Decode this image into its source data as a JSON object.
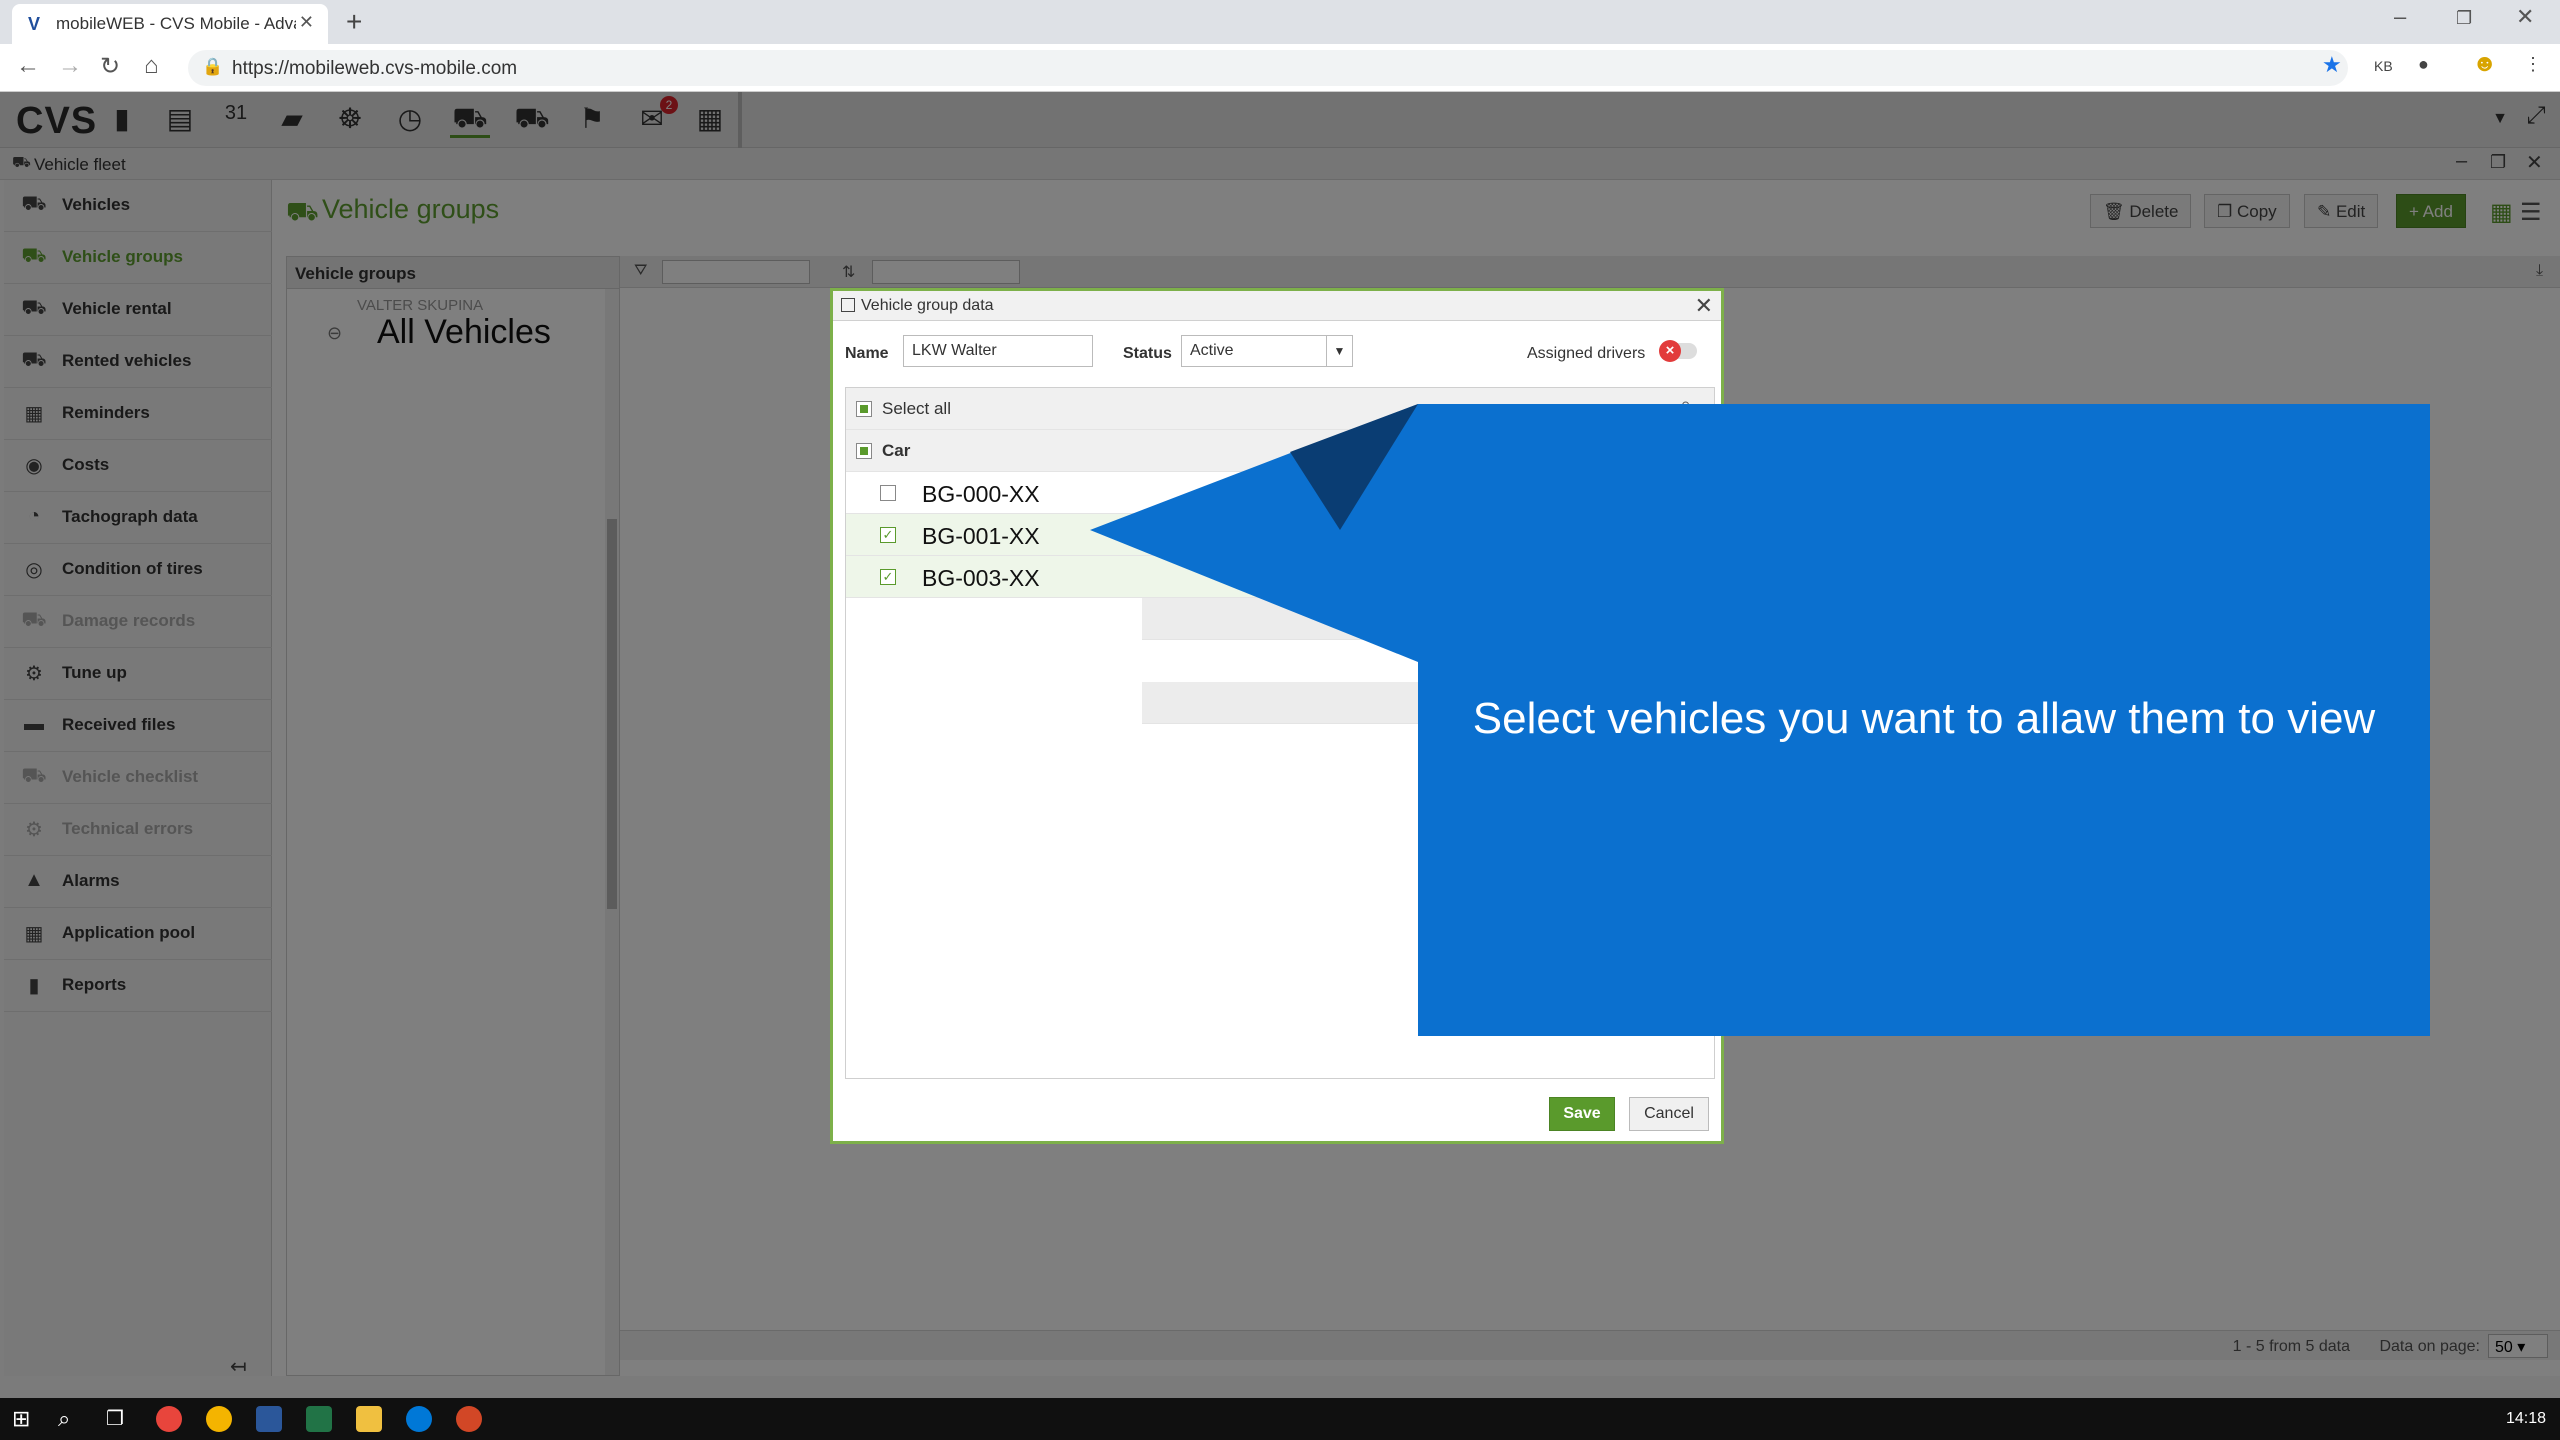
{
  "browser": {
    "tab_title": "mobileWEB - CVS Mobile - Adva",
    "favicon": "V",
    "url": "https://mobileweb.cvs-mobile.com"
  },
  "app": {
    "logo": "CVS",
    "message_badge": "2",
    "window_title": "Vehicle fleet",
    "page_title": "Vehicle groups",
    "toolbar_buttons": {
      "delete": "Delete",
      "copy": "Copy",
      "edit": "Edit",
      "add": "+ Add"
    }
  },
  "sidebar": {
    "items": [
      {
        "label": "Vehicles",
        "icon": "⛟",
        "state": "normal"
      },
      {
        "label": "Vehicle groups",
        "icon": "⛟",
        "state": "active"
      },
      {
        "label": "Vehicle rental",
        "icon": "⛟",
        "state": "normal"
      },
      {
        "label": "Rented vehicles",
        "icon": "⛟",
        "state": "normal"
      },
      {
        "label": "Reminders",
        "icon": "▦",
        "state": "normal"
      },
      {
        "label": "Costs",
        "icon": "◉",
        "state": "normal"
      },
      {
        "label": "Tachograph data",
        "icon": "◔",
        "state": "normal"
      },
      {
        "label": "Condition of tires",
        "icon": "◎",
        "state": "normal"
      },
      {
        "label": "Damage records",
        "icon": "⛟",
        "state": "disabled"
      },
      {
        "label": "Tune up",
        "icon": "⚙",
        "state": "normal"
      },
      {
        "label": "Received files",
        "icon": "▬",
        "state": "normal"
      },
      {
        "label": "Vehicle checklist",
        "icon": "⛟",
        "state": "disabled"
      },
      {
        "label": "Technical errors",
        "icon": "⚙",
        "state": "disabled"
      },
      {
        "label": "Alarms",
        "icon": "▲",
        "state": "normal"
      },
      {
        "label": "Application pool",
        "icon": "▦",
        "state": "normal"
      },
      {
        "label": "Reports",
        "icon": "▮",
        "state": "normal"
      }
    ]
  },
  "group_panel": {
    "header": "Vehicle groups",
    "subgroup": "VALTER SKUPINA",
    "node": "All Vehicles"
  },
  "grid_footer": {
    "info": "1 - 5 from 5 data",
    "page_label": "Data on page:",
    "page_size": "50"
  },
  "dialog": {
    "title": "Vehicle group data",
    "name_label": "Name",
    "name_value": "LKW Walter",
    "status_label": "Status",
    "status_value": "Active",
    "drivers_label": "Assigned drivers",
    "select_all": "Select all",
    "category": "Car",
    "vehicles": [
      {
        "plate": "BG-000-XX",
        "checked": false
      },
      {
        "plate": "BG-001-XX",
        "checked": true
      },
      {
        "plate": "BG-003-XX",
        "checked": true
      }
    ],
    "save": "Save",
    "cancel": "Cancel"
  },
  "callout": {
    "text": "Select vehicles you want to allaw them to view",
    "color": "#0b70cf"
  },
  "taskbar": {
    "clock": "14:18"
  }
}
